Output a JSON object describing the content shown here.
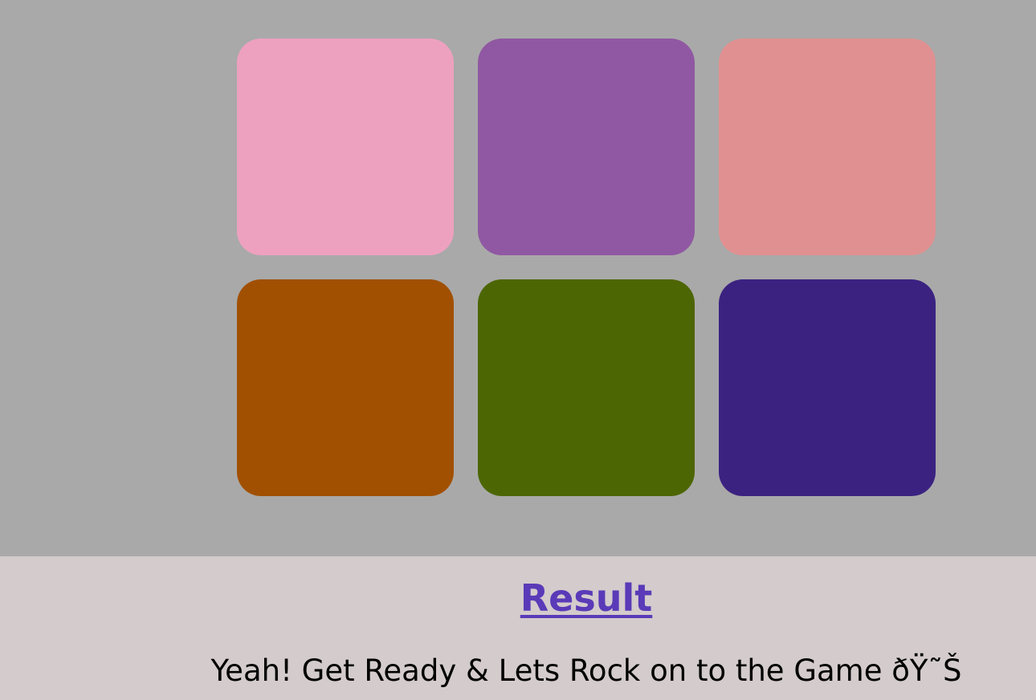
{
  "board": {
    "tiles": [
      {
        "color": "#eda1bf"
      },
      {
        "color": "#9058a2"
      },
      {
        "color": "#e09090"
      },
      {
        "color": "#a15002"
      },
      {
        "color": "#4d6604"
      },
      {
        "color": "#3b2281"
      }
    ]
  },
  "result": {
    "heading": "Result",
    "message": "Yeah! Get Ready & Lets Rock on to the Game ðŸ˜Š"
  }
}
